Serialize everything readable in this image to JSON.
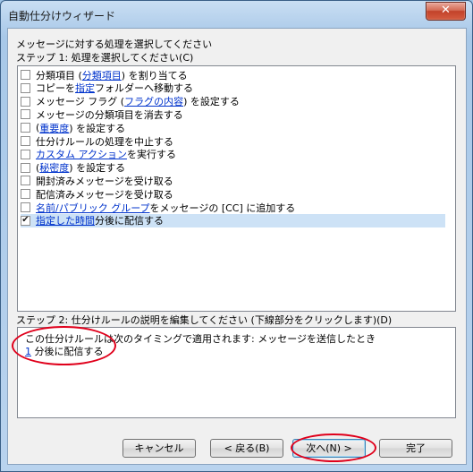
{
  "window": {
    "title": "自動仕分けウィザード",
    "close_glyph": "✕"
  },
  "step1": {
    "heading": "メッセージに対する処理を選択してください",
    "label": "ステップ 1: 処理を選択してください(C)",
    "actions": [
      {
        "checked": false,
        "parts": [
          {
            "t": "分類項目 ("
          },
          {
            "t": "分類項目",
            "link": true
          },
          {
            "t": ") を割り当てる"
          }
        ]
      },
      {
        "checked": false,
        "parts": [
          {
            "t": "コピーを "
          },
          {
            "t": "指定",
            "link": true
          },
          {
            "t": " フォルダーへ移動する"
          }
        ]
      },
      {
        "checked": false,
        "parts": [
          {
            "t": "メッセージ フラグ ("
          },
          {
            "t": "フラグの内容",
            "link": true
          },
          {
            "t": ") を設定する"
          }
        ]
      },
      {
        "checked": false,
        "parts": [
          {
            "t": "メッセージの分類項目を消去する"
          }
        ]
      },
      {
        "checked": false,
        "parts": [
          {
            "t": "("
          },
          {
            "t": "重要度",
            "link": true
          },
          {
            "t": ") を設定する"
          }
        ]
      },
      {
        "checked": false,
        "parts": [
          {
            "t": "仕分けルールの処理を中止する"
          }
        ]
      },
      {
        "checked": false,
        "parts": [
          {
            "t": "カスタム アクション",
            "link": true
          },
          {
            "t": " を実行する"
          }
        ]
      },
      {
        "checked": false,
        "parts": [
          {
            "t": "("
          },
          {
            "t": "秘密度",
            "link": true
          },
          {
            "t": ") を設定する"
          }
        ]
      },
      {
        "checked": false,
        "parts": [
          {
            "t": "開封済みメッセージを受け取る"
          }
        ]
      },
      {
        "checked": false,
        "parts": [
          {
            "t": "配信済みメッセージを受け取る"
          }
        ]
      },
      {
        "checked": false,
        "parts": [
          {
            "t": "名前/パブリック グループ",
            "link": true
          },
          {
            "t": " をメッセージの [CC] に追加する"
          }
        ]
      },
      {
        "checked": true,
        "selected": true,
        "parts": [
          {
            "t": "指定した時間",
            "link": true
          },
          {
            "t": " 分後に配信する"
          }
        ]
      }
    ]
  },
  "step2": {
    "label": "ステップ 2: 仕分けルールの説明を編集してください (下線部分をクリックします)(D)",
    "line1": "この仕分けルールは次のタイミングで適用されます: メッセージを送信したとき",
    "line2_link": "1",
    "line2_text": " 分後に配信する"
  },
  "buttons": {
    "cancel": "キャンセル",
    "back": "< 戻る(B)",
    "next": "次へ(N) >",
    "finish": "完了"
  },
  "annotation_color": "#e0001b"
}
